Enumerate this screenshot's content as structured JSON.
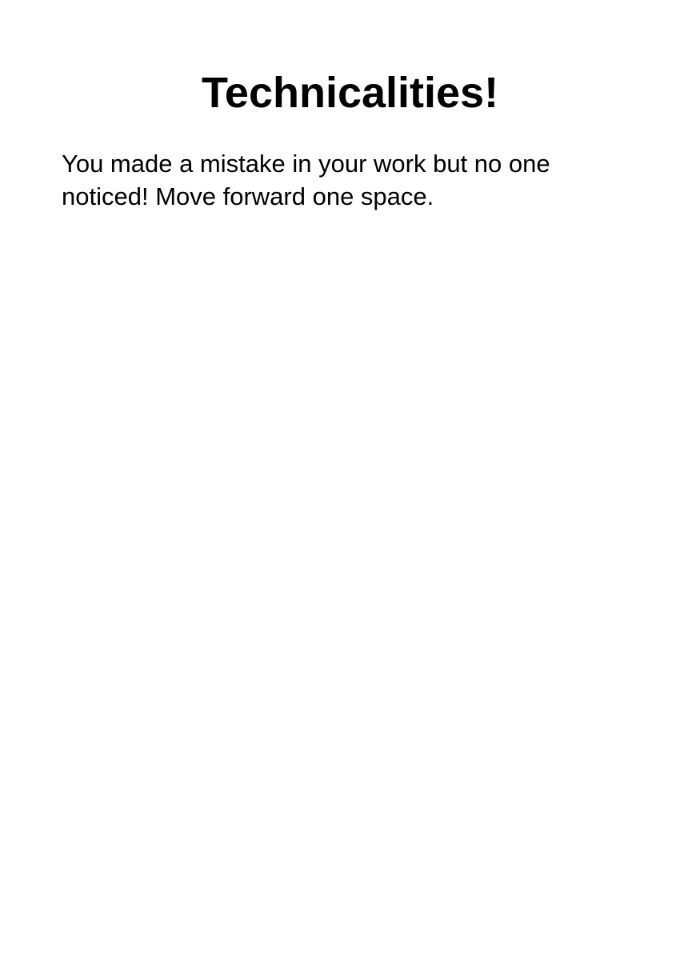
{
  "card": {
    "title": "Technicalities!",
    "body": "You made a mistake in your work but no one noticed! Move forward one space."
  }
}
